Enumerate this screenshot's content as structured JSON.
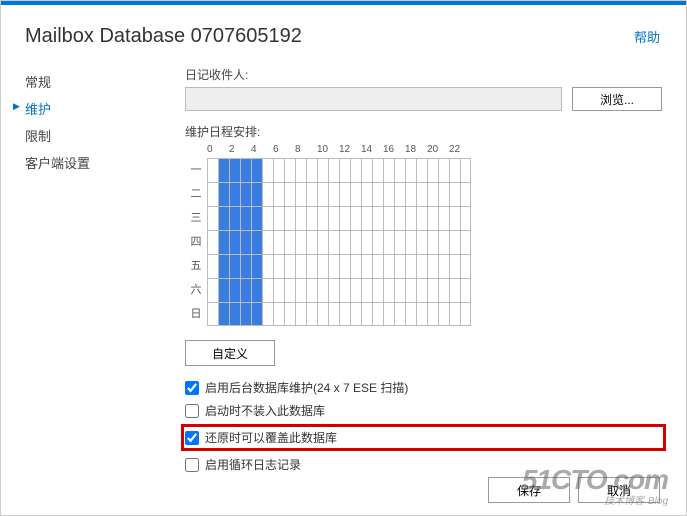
{
  "header": {
    "title": "Mailbox Database 0707605192",
    "help": "帮助"
  },
  "sidebar": {
    "items": [
      {
        "label": "常规"
      },
      {
        "label": "维护"
      },
      {
        "label": "限制"
      },
      {
        "label": "客户端设置"
      }
    ],
    "activeIndex": 1
  },
  "main": {
    "journalRecipientLabel": "日记收件人:",
    "journalRecipientValue": "",
    "browseLabel": "浏览...",
    "scheduleLabel": "维护日程安排:",
    "customizeLabel": "自定义",
    "checkboxes": [
      {
        "label": "启用后台数据库维护(24 x 7 ESE 扫描)",
        "checked": true,
        "highlighted": false
      },
      {
        "label": "启动时不装入此数据库",
        "checked": false,
        "highlighted": false
      },
      {
        "label": "还原时可以覆盖此数据库",
        "checked": true,
        "highlighted": true
      },
      {
        "label": "启用循环日志记录",
        "checked": false,
        "highlighted": false
      }
    ]
  },
  "schedule": {
    "hoursVisible": [
      "0",
      "",
      "2",
      "",
      "4",
      "",
      "6",
      "",
      "8",
      "",
      "10",
      "",
      "12",
      "",
      "14",
      "",
      "16",
      "",
      "18",
      "",
      "20",
      "",
      "22",
      ""
    ],
    "days": [
      "一",
      "二",
      "三",
      "四",
      "五",
      "六",
      "日"
    ],
    "selectedHours": [
      1,
      2,
      3,
      4
    ]
  },
  "footer": {
    "save": "保存",
    "cancel": "取消"
  },
  "watermark": {
    "line1": "51CTO.com",
    "line2": "技术博客",
    "line2suffix": "Blog"
  }
}
